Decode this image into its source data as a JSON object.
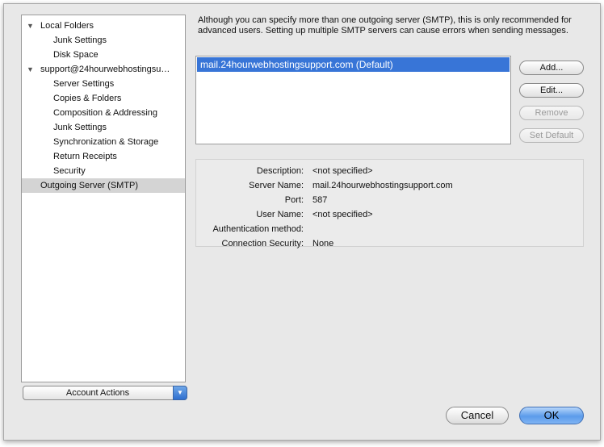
{
  "sidebar": {
    "items": [
      {
        "label": "Local Folders",
        "level": 0,
        "expanded": true
      },
      {
        "label": "Junk Settings",
        "level": 1
      },
      {
        "label": "Disk Space",
        "level": 1
      },
      {
        "label": "support@24hourwebhostingsu…",
        "level": 0,
        "expanded": true
      },
      {
        "label": "Server Settings",
        "level": 1
      },
      {
        "label": "Copies & Folders",
        "level": 1
      },
      {
        "label": "Composition & Addressing",
        "level": 1
      },
      {
        "label": "Junk Settings",
        "level": 1
      },
      {
        "label": "Synchronization & Storage",
        "level": 1
      },
      {
        "label": "Return Receipts",
        "level": 1
      },
      {
        "label": "Security",
        "level": 1
      },
      {
        "label": "Outgoing Server (SMTP)",
        "level": 0,
        "selected": true
      }
    ],
    "disclosure_glyph": "▼"
  },
  "account_actions": {
    "label": "Account Actions",
    "arrow_glyph": "▼"
  },
  "smtp": {
    "description": "Although you can specify more than one outgoing server (SMTP), this is only recommended for advanced users. Setting up multiple SMTP servers can cause errors when sending messages.",
    "servers": [
      "mail.24hourwebhostingsupport.com (Default)"
    ],
    "buttons": {
      "add": "Add...",
      "edit": "Edit...",
      "remove": "Remove",
      "set_default": "Set Default"
    },
    "details": {
      "description_label": "Description:",
      "description_value": "<not specified>",
      "server_name_label": "Server Name:",
      "server_name_value": "mail.24hourwebhostingsupport.com",
      "port_label": "Port:",
      "port_value": "587",
      "user_name_label": "User Name:",
      "user_name_value": "<not specified>",
      "auth_label": "Authentication method:",
      "auth_value": "",
      "security_label": "Connection Security:",
      "security_value": "None"
    }
  },
  "dialog": {
    "cancel": "Cancel",
    "ok": "OK"
  },
  "colors": {
    "selection": "#3875d7",
    "default_button": "#5b9bea"
  }
}
